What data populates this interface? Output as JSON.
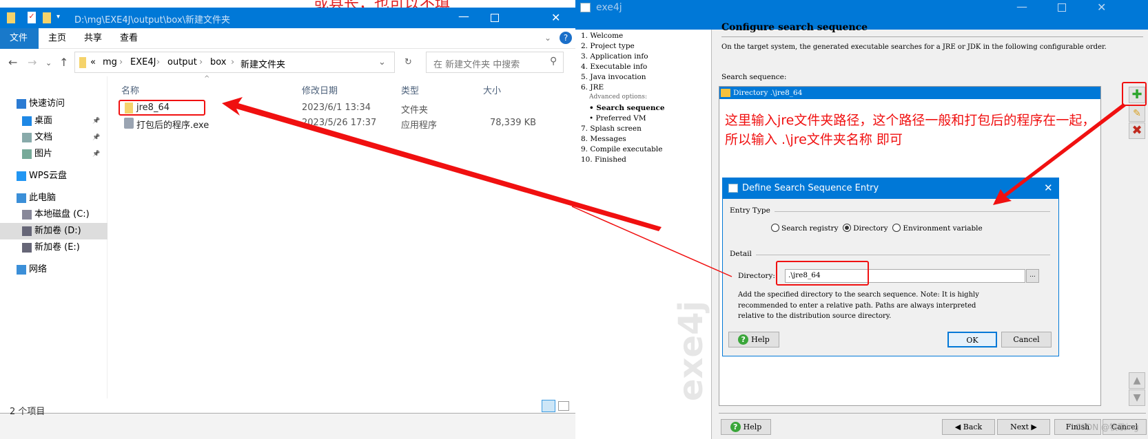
{
  "background_annotation": "或县长，也可以不填",
  "explorer": {
    "title_path": "D:\\mg\\EXE4J\\output\\box\\新建文件夹",
    "ribbon_tabs": [
      "文件",
      "主页",
      "共享",
      "查看"
    ],
    "breadcrumb": [
      "«",
      "mg",
      "EXE4J",
      "output",
      "box",
      "新建文件夹"
    ],
    "search_placeholder": "在 新建文件夹 中搜索",
    "sidebar": [
      "快速访问",
      "桌面",
      "文档",
      "图片",
      "WPS云盘",
      "此电脑",
      "本地磁盘 (C:)",
      "新加卷 (D:)",
      "新加卷 (E:)",
      "网络"
    ],
    "columns": [
      "名称",
      "修改日期",
      "类型",
      "大小"
    ],
    "files": [
      {
        "name": "jre8_64",
        "date": "2023/6/1 13:34",
        "type": "文件夹",
        "size": ""
      },
      {
        "name": "打包后的程序.exe",
        "date": "2023/5/26 17:37",
        "type": "应用程序",
        "size": "78,339 KB"
      }
    ],
    "status": "2 个项目"
  },
  "exe4j": {
    "title": "exe4j",
    "steps": [
      "1. Welcome",
      "2. Project type",
      "3. Application info",
      "4. Executable info",
      "5. Java invocation",
      "6. JRE",
      "Advanced options:",
      "• Search sequence",
      "• Preferred VM",
      "7. Splash screen",
      "8. Messages",
      "9. Compile executable",
      "10. Finished"
    ],
    "watermark": "exe4j",
    "heading": "Configure search sequence",
    "description": "On the target system, the generated executable searches for a JRE or JDK in the following configurable order.",
    "sequence_label": "Search sequence:",
    "sequence_items": [
      "Directory .\\jre8_64"
    ],
    "buttons": {
      "help": "Help",
      "back": "Back",
      "next": "Next",
      "finish": "Finish",
      "cancel": "Cancel"
    },
    "credit": "CSDN @牧歌ing"
  },
  "dialog": {
    "title": "Define Search Sequence Entry",
    "entry_type_label": "Entry Type",
    "options": [
      "Search registry",
      "Directory",
      "Environment variable"
    ],
    "selected_option": "Directory",
    "detail_label": "Detail",
    "directory_label": "Directory:",
    "directory_value": ".\\jre8_64",
    "browse": "...",
    "note": [
      "Add the specified directory to the search sequence. Note: It is highly",
      "recommended to enter a relative path. Paths are always interpreted",
      "relative to the distribution source directory."
    ],
    "help": "Help",
    "ok": "OK",
    "cancel": "Cancel"
  },
  "annotation": {
    "line1": "这里输入jre文件夹路径，这个路径一般和打包后的程序在一起，",
    "line2": "所以输入 .\\jre文件夹名称  即可",
    "color": "#f01010"
  }
}
